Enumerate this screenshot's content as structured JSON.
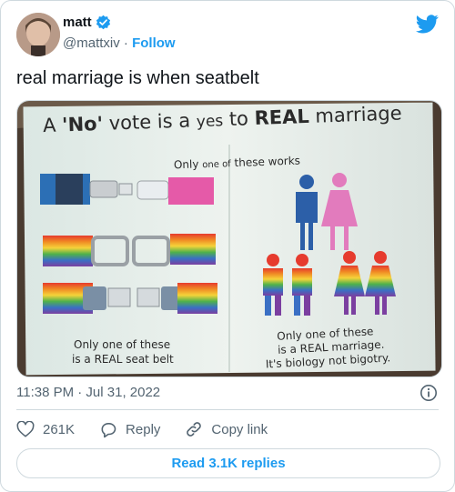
{
  "author": {
    "name": "matt",
    "handle": "@mattxiv",
    "separator": "·",
    "follow_label": "Follow"
  },
  "tweet": {
    "text": "real marriage is when seatbelt",
    "timestamp": "11:38 PM · Jul 31, 2022"
  },
  "image": {
    "headline_prefix": "A",
    "headline_no": "'No'",
    "headline_rest_1": "vote is a",
    "headline_yes": "yes",
    "headline_to": "to",
    "headline_real": "REAL",
    "headline_marriage": "marriage",
    "subtitle_prefix": "Only",
    "subtitle_one_of": "one of",
    "subtitle_suffix": "these works",
    "left_caption_line1": "Only one of these",
    "left_caption_line2": "is a REAL seat belt",
    "right_caption_line1": "Only one of these",
    "right_caption_line2": "is a REAL marriage.",
    "right_caption_line3": "It's biology not bigotry."
  },
  "actions": {
    "like_count": "261K",
    "reply_label": "Reply",
    "copy_link_label": "Copy link"
  },
  "read_replies_label": "Read 3.1K replies",
  "colors": {
    "accent": "#1d9bf0",
    "text_primary": "#0f1419",
    "text_secondary": "#536471",
    "border": "#cfd9de"
  }
}
